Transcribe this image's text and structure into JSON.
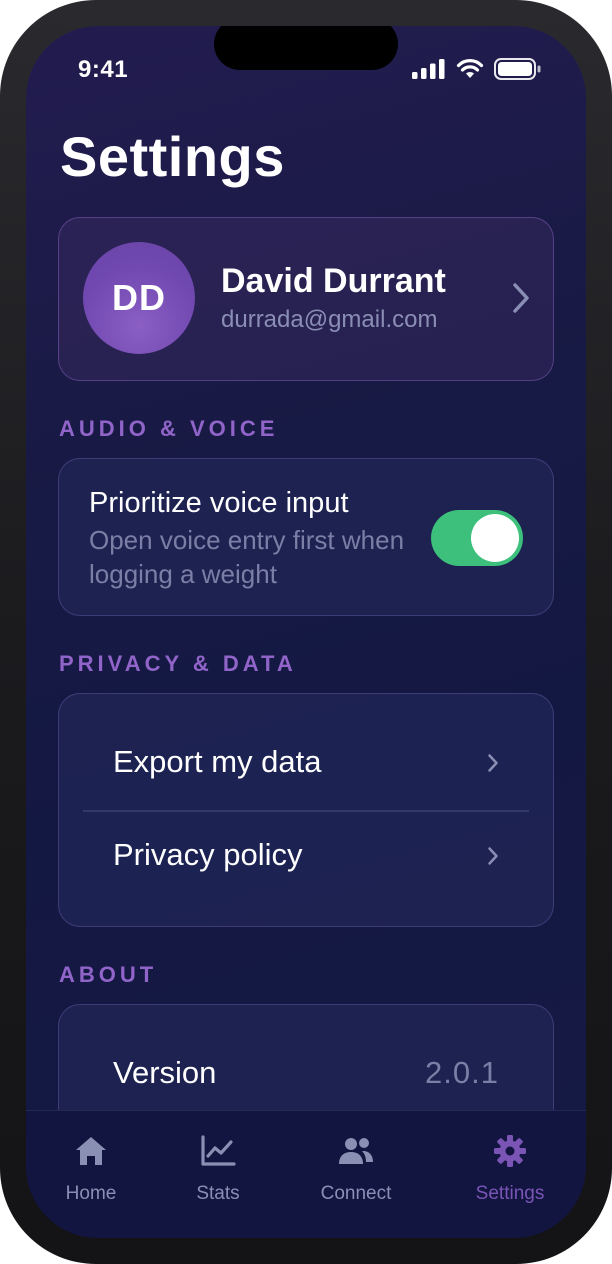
{
  "status_bar": {
    "time": "9:41"
  },
  "header": {
    "title": "Settings"
  },
  "profile": {
    "initials": "DD",
    "name": "David Durrant",
    "email": "durrada@gmail.com"
  },
  "sections": {
    "audio_voice": {
      "label": "AUDIO & VOICE",
      "voice_title": "Prioritize voice input",
      "voice_subtitle": "Open voice entry first when logging a weight",
      "voice_toggle_on": true
    },
    "privacy_data": {
      "label": "PRIVACY & DATA",
      "items": [
        {
          "label": "Export my data"
        },
        {
          "label": "Privacy policy"
        }
      ]
    },
    "about": {
      "label": "ABOUT",
      "version_label": "Version",
      "version_value": "2.0.1"
    }
  },
  "tabbar": {
    "tabs": [
      {
        "label": "Home",
        "icon": "home-icon"
      },
      {
        "label": "Stats",
        "icon": "chart-icon"
      },
      {
        "label": "Connect",
        "icon": "people-icon"
      },
      {
        "label": "Settings",
        "icon": "gear-icon",
        "active": true
      }
    ]
  },
  "colors": {
    "accent": "#9064c8",
    "toggle_on": "#3cc07c",
    "background": "#161a45"
  }
}
